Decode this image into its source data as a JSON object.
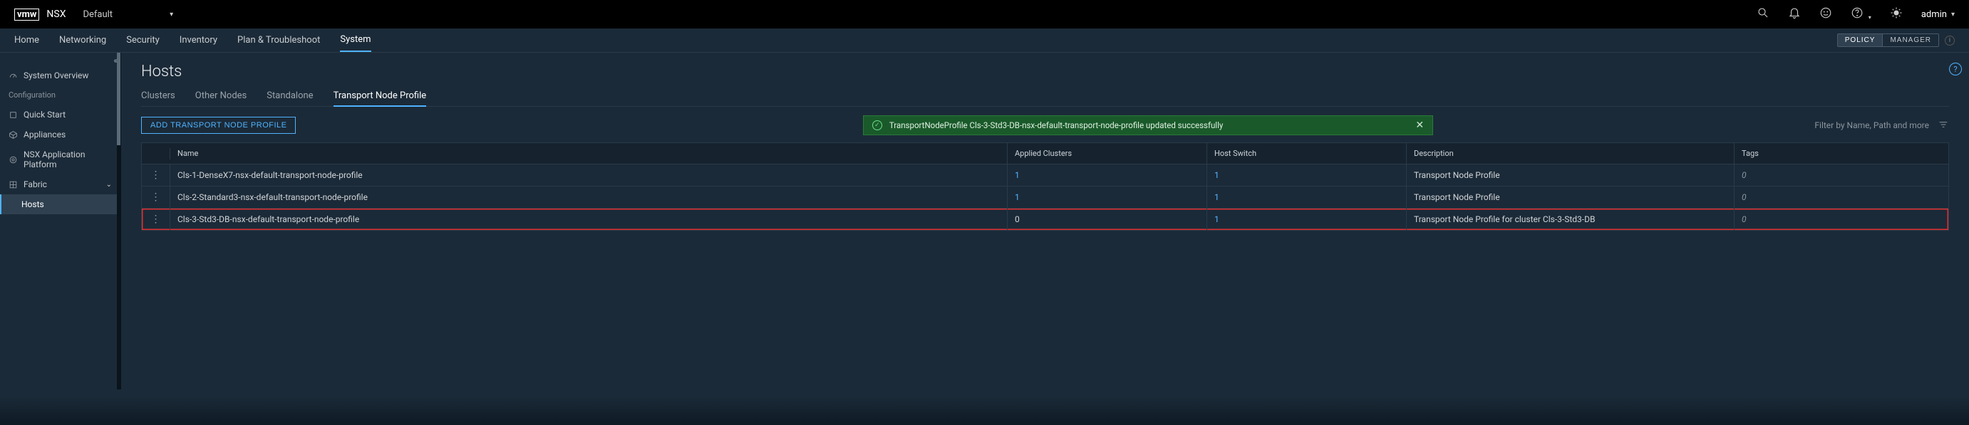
{
  "topbar": {
    "logo_text": "vmw",
    "product": "NSX",
    "scope": "Default",
    "user": "admin"
  },
  "nav": {
    "items": [
      "Home",
      "Networking",
      "Security",
      "Inventory",
      "Plan & Troubleshoot",
      "System"
    ],
    "active_index": 5,
    "policy_label": "POLICY",
    "manager_label": "MANAGER"
  },
  "sidebar": {
    "overview": "System Overview",
    "config_header": "Configuration",
    "quick_start": "Quick Start",
    "appliances": "Appliances",
    "nsx_app": "NSX Application Platform",
    "fabric": "Fabric",
    "hosts": "Hosts"
  },
  "main": {
    "title": "Hosts",
    "tabs": [
      "Clusters",
      "Other Nodes",
      "Standalone",
      "Transport Node Profile"
    ],
    "active_tab": 3,
    "add_button": "ADD TRANSPORT NODE PROFILE",
    "alert_text": "TransportNodeProfile Cls-3-Std3-DB-nsx-default-transport-node-profile updated successfully",
    "filter_placeholder": "Filter by Name, Path and more"
  },
  "table": {
    "headers": {
      "name": "Name",
      "applied": "Applied Clusters",
      "hostswitch": "Host Switch",
      "description": "Description",
      "tags": "Tags"
    },
    "rows": [
      {
        "name": "Cls-1-DenseX7-nsx-default-transport-node-profile",
        "applied": "1",
        "hostswitch": "1",
        "description": "Transport Node Profile",
        "tags": "0",
        "highlighted": false
      },
      {
        "name": "Cls-2-Standard3-nsx-default-transport-node-profile",
        "applied": "1",
        "hostswitch": "1",
        "description": "Transport Node Profile",
        "tags": "0",
        "highlighted": false
      },
      {
        "name": "Cls-3-Std3-DB-nsx-default-transport-node-profile",
        "applied": "0",
        "hostswitch": "1",
        "description": "Transport Node Profile for cluster Cls-3-Std3-DB",
        "tags": "0",
        "highlighted": true
      }
    ]
  }
}
